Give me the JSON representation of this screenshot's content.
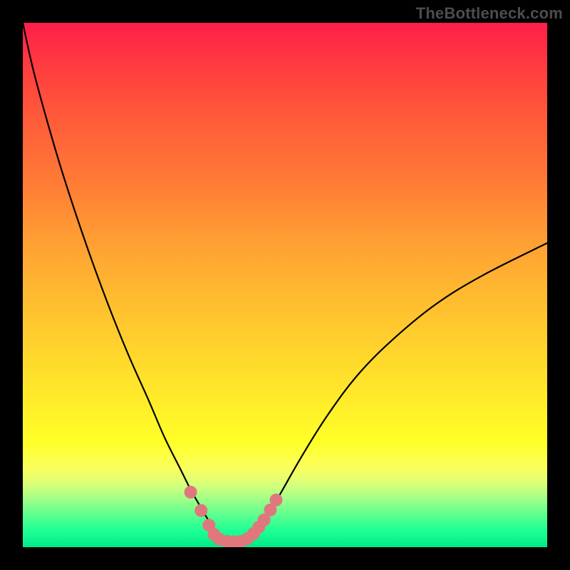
{
  "watermark": "TheBottleneck.com",
  "chart_data": {
    "type": "line",
    "title": "",
    "xlabel": "",
    "ylabel": "",
    "xlim": [
      0,
      100
    ],
    "ylim": [
      0,
      100
    ],
    "grid": false,
    "legend": false,
    "curve": {
      "x": [
        0,
        2,
        5,
        8,
        12,
        16,
        20,
        24,
        27,
        30,
        32,
        34,
        35.5,
        37,
        39,
        41,
        42.5,
        44,
        46,
        49,
        53,
        58,
        64,
        71,
        79,
        88,
        100
      ],
      "y": [
        100,
        91,
        80,
        70,
        58,
        47,
        37,
        28,
        21,
        15,
        11,
        7.5,
        5,
        3,
        1.4,
        0.8,
        1.2,
        2.5,
        5,
        10,
        17,
        25,
        33,
        40,
        46.5,
        52,
        58
      ]
    },
    "markers": {
      "color": "#e0777d",
      "radius_px": 9,
      "points_xy": [
        [
          32,
          10.5
        ],
        [
          34,
          7
        ],
        [
          35.5,
          4.2
        ],
        [
          36.5,
          2.4
        ],
        [
          37.5,
          1.5
        ],
        [
          39,
          1.1
        ],
        [
          40.2,
          1.0
        ],
        [
          41.5,
          1.1
        ],
        [
          42.8,
          1.6
        ],
        [
          44,
          2.6
        ],
        [
          45,
          3.8
        ],
        [
          46,
          5.2
        ],
        [
          47.2,
          7.1
        ],
        [
          48.3,
          9.0
        ]
      ]
    },
    "background_gradient": {
      "top": "#ff1e4a",
      "mid": "#ffe22b",
      "bottom": "#00e887"
    }
  }
}
